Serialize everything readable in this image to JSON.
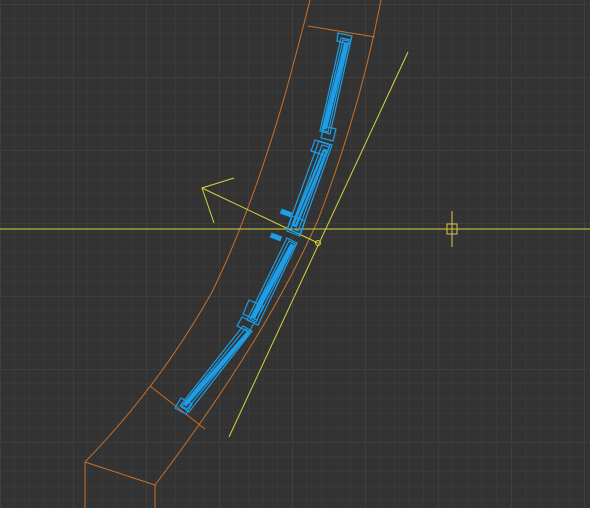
{
  "viewport": {
    "background": "#333333",
    "grid_color": "#3f3f3f",
    "grid_major_color": "#474747"
  },
  "colors": {
    "wall_outline": "#c8702a",
    "window_element": "#1c9ee8",
    "guide_line": "#d7d43a",
    "cursor": "#c9b44a"
  },
  "icons": {
    "crosshair": "crosshair-cursor-icon",
    "insertion_point": "insertion-point-marker-icon"
  }
}
